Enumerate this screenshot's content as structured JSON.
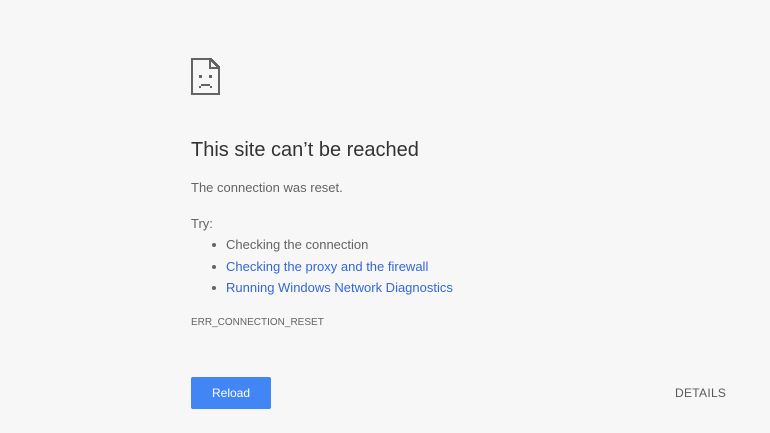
{
  "error_page": {
    "icon": "sad-document-icon",
    "title": "This site can’t be reached",
    "message": "The connection was reset.",
    "try_label": "Try:",
    "suggestions": [
      {
        "text": "Checking the connection",
        "is_link": false
      },
      {
        "text": "Checking the proxy and the firewall",
        "is_link": true
      },
      {
        "text": "Running Windows Network Diagnostics",
        "is_link": true
      }
    ],
    "error_code": "ERR_CONNECTION_RESET",
    "reload_label": "Reload",
    "details_label": "DETAILS"
  },
  "colors": {
    "background": "#f7f7f7",
    "link": "#3367d6",
    "button": "#4285f4",
    "text": "#646464",
    "title": "#333333"
  }
}
